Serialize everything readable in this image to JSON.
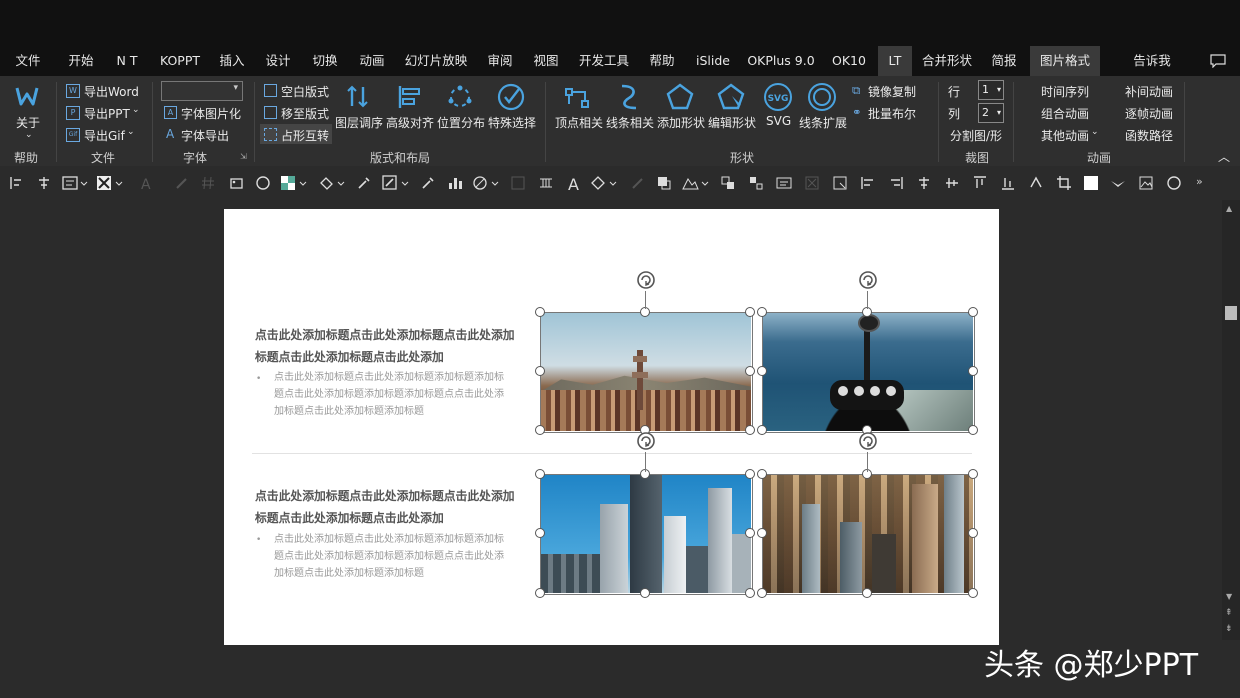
{
  "menu": {
    "tabs": [
      "文件",
      "开始",
      "N T",
      "KOPPT",
      "插入",
      "设计",
      "切换",
      "动画",
      "幻灯片放映",
      "审阅",
      "视图",
      "开发工具",
      "帮助",
      "iSlide",
      "OKPlus 9.0",
      "OK10",
      "LT",
      "合并形状",
      "简报",
      "图片格式"
    ],
    "selected": "LT",
    "tell_me": "告诉我",
    "comment_icon": "comment-icon"
  },
  "ribbon": {
    "help_group": {
      "about": "关于",
      "label": "帮助"
    },
    "file_group": {
      "export_word": "导出Word",
      "export_ppt": "导出PPT",
      "export_gif": "导出Gif",
      "label": "文件"
    },
    "font_group": {
      "font_to_image": "字体图片化",
      "font_export": "字体导出",
      "label": "字体"
    },
    "layout_group": {
      "blank_layout": "空白版式",
      "move_to_layout": "移至版式",
      "placeholder_swap": "占形互转",
      "layer_order": "图层调序",
      "advanced_align": "高级对齐",
      "position_dist": "位置分布",
      "special_select": "特殊选择",
      "label": "版式和布局"
    },
    "shape_group": {
      "vertex": "顶点相关",
      "lines": "线条相关",
      "add_shape": "添加形状",
      "edit_shape": "编辑形状",
      "svg": "SVG",
      "line_expand": "线条扩展",
      "mirror_copy": "镜像复制",
      "batch_bool": "批量布尔",
      "label": "形状"
    },
    "crop_group": {
      "row_label": "行",
      "row_value": "1",
      "col_label": "列",
      "col_value": "2",
      "split": "分割图/形",
      "label": "裁图"
    },
    "anim_group": {
      "time_seq": "时间序列",
      "group_anim": "组合动画",
      "other_anim": "其他动画",
      "tween": "补间动画",
      "frame_by_frame": "逐帧动画",
      "func_path": "函数路径",
      "label": "动画"
    },
    "accent": "#4aa3df"
  },
  "slide": {
    "sections": [
      {
        "title": "点击此处添加标题点击此处添加标题点击此处添加标题点击此处添加标题点击此处添加",
        "body": "点击此处添加标题点击此处添加标题添加标题添加标题点击此处添加标题添加标题添加标题点点击此处添加标题点击此处添加标题添加标题"
      },
      {
        "title": "点击此处添加标题点击此处添加标题点击此处添加标题点击此处添加标题点击此处添加",
        "body": "点击此处添加标题点击此处添加标题添加标题添加标题点击此处添加标题添加标题添加标题点点击此处添加标题点击此处添加标题添加标题"
      }
    ],
    "photos": [
      "city-tower-photo",
      "helicopter-cockpit-photo",
      "skyscrapers-photo",
      "city-aerial-photo"
    ]
  },
  "watermark": "头条 @郑少PPT"
}
